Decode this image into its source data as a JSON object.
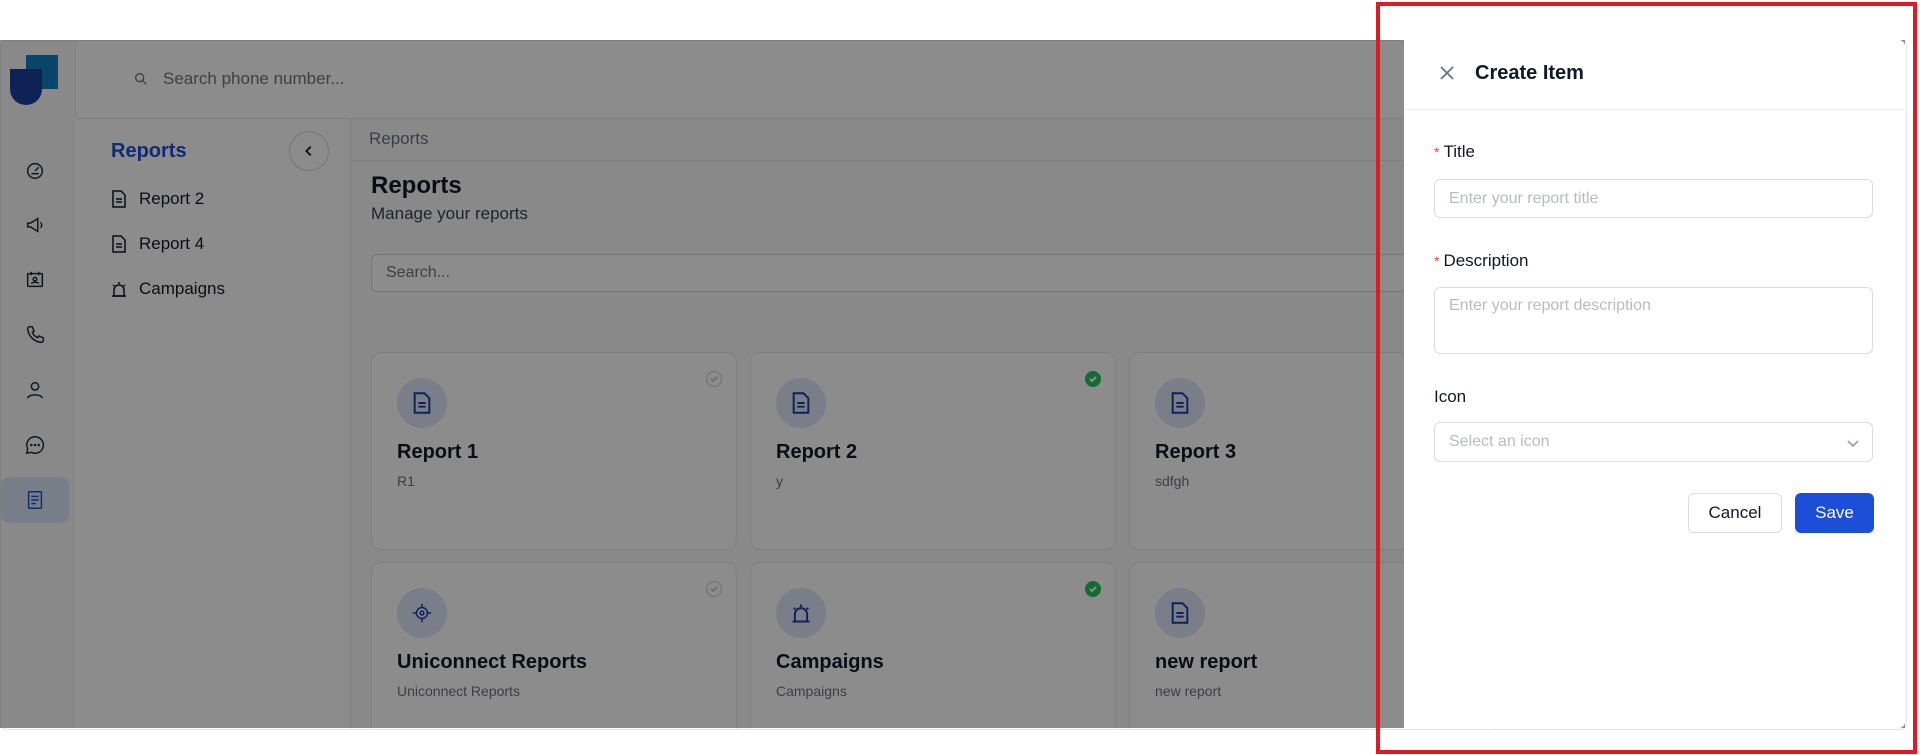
{
  "topbar": {
    "search_placeholder": "Search phone number..."
  },
  "rail": {
    "icons": [
      "dashboard-icon",
      "megaphone-icon",
      "contact-card-icon",
      "phone-icon",
      "user-icon",
      "chat-icon",
      "report-icon"
    ],
    "active": "report-icon"
  },
  "sidepanel": {
    "title": "Reports",
    "items": [
      {
        "label": "Report 2",
        "icon": "document-icon"
      },
      {
        "label": "Report 4",
        "icon": "document-icon"
      },
      {
        "label": "Campaigns",
        "icon": "alarm-icon"
      }
    ]
  },
  "main": {
    "breadcrumb": "Reports",
    "title": "Reports",
    "subtitle": "Manage your reports",
    "search_placeholder": "Search...",
    "cards": [
      {
        "title": "Report 1",
        "subtitle": "R1",
        "icon": "document-icon",
        "checked": false
      },
      {
        "title": "Report 2",
        "subtitle": "y",
        "icon": "document-icon",
        "checked": true
      },
      {
        "title": "Report 3",
        "subtitle": "sdfgh",
        "icon": "document-icon",
        "checked": null
      },
      {
        "title": "Uniconnect Reports",
        "subtitle": "Uniconnect Reports",
        "icon": "crosshair-icon",
        "checked": false
      },
      {
        "title": "Campaigns",
        "subtitle": "Campaigns",
        "icon": "alarm-icon",
        "checked": true
      },
      {
        "title": "new report",
        "subtitle": "new report",
        "icon": "document-icon",
        "checked": null
      }
    ]
  },
  "drawer": {
    "title": "Create Item",
    "title_label": "Title",
    "title_placeholder": "Enter your report title",
    "description_label": "Description",
    "description_placeholder": "Enter your report description",
    "icon_label": "Icon",
    "icon_placeholder": "Select an icon",
    "required_mark": "*",
    "cancel_label": "Cancel",
    "save_label": "Save"
  },
  "colors": {
    "accent": "#1d4ed8",
    "success": "#22c55e",
    "required": "#ef4444",
    "highlight": "#e01a22"
  }
}
